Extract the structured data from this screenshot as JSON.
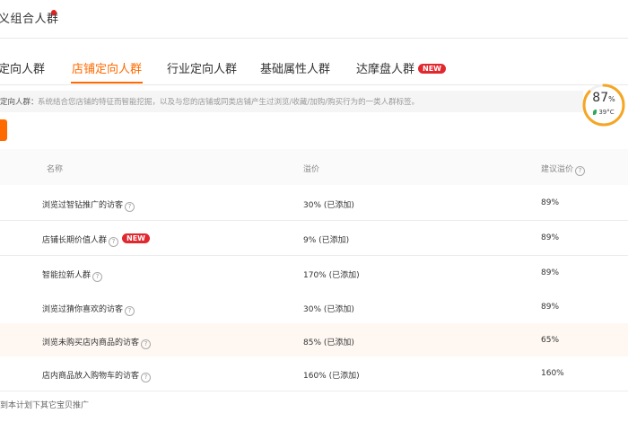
{
  "header": {
    "title": "义组合人群"
  },
  "tabs": [
    {
      "label": "定向人群",
      "active": false,
      "badge": ""
    },
    {
      "label": "店铺定向人群",
      "active": true,
      "badge": ""
    },
    {
      "label": "行业定向人群",
      "active": false,
      "badge": ""
    },
    {
      "label": "基础属性人群",
      "active": false,
      "badge": ""
    },
    {
      "label": "达摩盘人群",
      "active": false,
      "badge": "NEW"
    }
  ],
  "description": {
    "label": "定向人群：",
    "text": "系统结合您店铺的特征而智能挖掘，以及与您的店铺或同类店铺产生过浏览/收藏/加购/购买行为的一类人群标签。"
  },
  "gauge": {
    "value": "87",
    "unit": "%",
    "temp": "39°C"
  },
  "table": {
    "headers": {
      "name": "名称",
      "premium": "溢价",
      "suggested": "建议溢价"
    },
    "rows": [
      {
        "name": "浏览过智钻推广的访客",
        "badge": "",
        "premium": "30% (已添加)",
        "suggested": "89%"
      },
      {
        "name": "店铺长期价值人群",
        "badge": "NEW",
        "premium": "9% (已添加)",
        "suggested": "89%"
      },
      {
        "name": "智能拉新人群",
        "badge": "",
        "premium": "170% (已添加)",
        "suggested": "89%"
      },
      {
        "name": "浏览过猜你喜欢的访客",
        "badge": "",
        "premium": "30% (已添加)",
        "suggested": "89%"
      },
      {
        "name": "浏览未购买店内商品的访客",
        "badge": "",
        "premium": "85% (已添加)",
        "suggested": "65%"
      },
      {
        "name": "店内商品放入购物车的访客",
        "badge": "",
        "premium": "160% (已添加)",
        "suggested": "160%"
      }
    ]
  },
  "footer": {
    "text": "到本计划下其它宝贝推广"
  },
  "colors": {
    "accent": "#ff6a00",
    "badge": "#e0282e",
    "gauge_ring": "#f5a623",
    "row_highlight": "#fff8f2"
  }
}
